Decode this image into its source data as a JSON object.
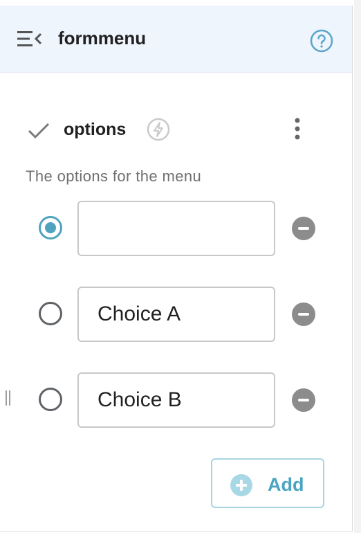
{
  "header": {
    "title": "formmenu",
    "menu_icon": "collapse-menu-icon",
    "help_icon": "help-icon"
  },
  "property": {
    "name": "options",
    "description": "The options for the menu",
    "status_icon": "check-icon",
    "dynamic_icon": "bolt-icon",
    "more_icon": "kebab-menu-icon"
  },
  "options": [
    {
      "value": "",
      "selected": true
    },
    {
      "value": "Choice A",
      "selected": false
    },
    {
      "value": "Choice B",
      "selected": false
    }
  ],
  "add_button": {
    "label": "Add"
  },
  "colors": {
    "accent": "#4fa3bf",
    "header_bg": "#eef5fc",
    "remove": "#8c8c8c"
  }
}
